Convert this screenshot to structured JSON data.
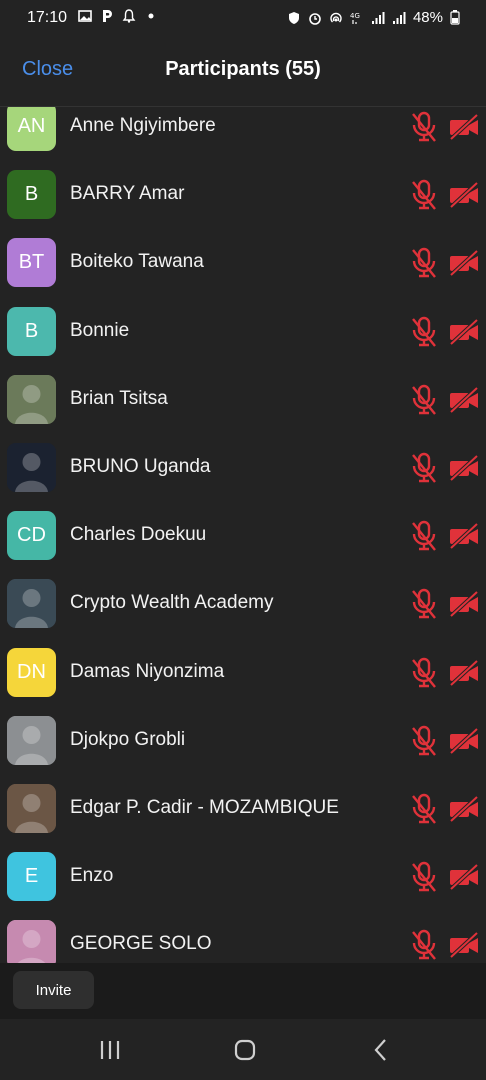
{
  "status": {
    "time": "17:10",
    "notification_icons": [
      "gallery-icon",
      "parking-p-icon",
      "bell-icon",
      "dot-icon"
    ],
    "system_icons": [
      "shield-icon",
      "alarm-icon",
      "hotspot-icon",
      "4g-signal-icon",
      "signal-icon",
      "signal-icon",
      "battery-icon"
    ],
    "battery": "48%"
  },
  "header": {
    "close_label": "Close",
    "title": "Participants (55)"
  },
  "participants": [
    {
      "initials": "AN",
      "name": "Anne Ngiyimbere",
      "color": "#a6d67b",
      "photo": false,
      "mic_muted": true,
      "video_off": true
    },
    {
      "initials": "B",
      "name": "BARRY Amar",
      "color": "#2f6b21",
      "photo": false,
      "mic_muted": true,
      "video_off": true
    },
    {
      "initials": "BT",
      "name": "Boiteko Tawana",
      "color": "#b07cd6",
      "photo": false,
      "mic_muted": true,
      "video_off": true
    },
    {
      "initials": "B",
      "name": "Bonnie",
      "color": "#4cb8ad",
      "photo": false,
      "mic_muted": true,
      "video_off": true
    },
    {
      "initials": "",
      "name": "Brian Tsitsa",
      "color": "#6b7a5a",
      "photo": true,
      "mic_muted": true,
      "video_off": true
    },
    {
      "initials": "",
      "name": "BRUNO Uganda",
      "color": "#1b2230",
      "photo": true,
      "mic_muted": true,
      "video_off": true
    },
    {
      "initials": "CD",
      "name": "Charles Doekuu",
      "color": "#45b7a6",
      "photo": false,
      "mic_muted": true,
      "video_off": true
    },
    {
      "initials": "",
      "name": "Crypto Wealth Academy",
      "color": "#3a4a55",
      "photo": true,
      "mic_muted": true,
      "video_off": true
    },
    {
      "initials": "DN",
      "name": "Damas Niyonzima",
      "color": "#f5d63a",
      "photo": false,
      "mic_muted": true,
      "video_off": true
    },
    {
      "initials": "",
      "name": "Djokpo Grobli",
      "color": "#8c8f92",
      "photo": true,
      "mic_muted": true,
      "video_off": true
    },
    {
      "initials": "",
      "name": "Edgar P. Cadir - MOZAMBIQUE",
      "color": "#6b5645",
      "photo": true,
      "mic_muted": true,
      "video_off": true
    },
    {
      "initials": "E",
      "name": "Enzo",
      "color": "#3fc4df",
      "photo": false,
      "mic_muted": true,
      "video_off": true
    },
    {
      "initials": "",
      "name": "GEORGE SOLO",
      "color": "#c68ab0",
      "photo": true,
      "mic_muted": true,
      "video_off": true
    }
  ],
  "footer": {
    "invite_label": "Invite"
  },
  "colors": {
    "background": "#232323",
    "accent": "#4a8eea",
    "muted_red": "#e0323a"
  },
  "nav": {
    "icons": [
      "recent-apps-icon",
      "home-icon",
      "back-icon"
    ]
  }
}
